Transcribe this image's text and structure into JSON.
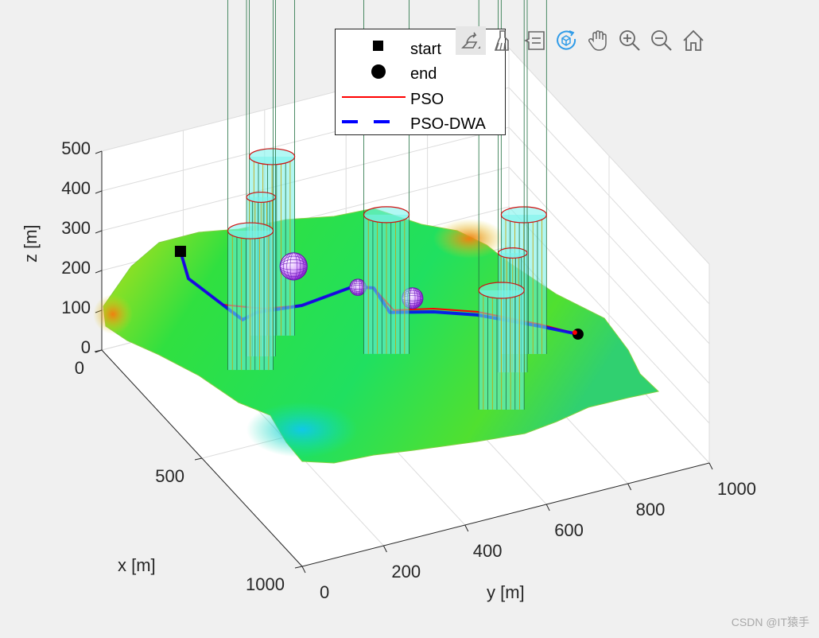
{
  "chart_data": {
    "type": "surface3d",
    "title": "",
    "xlabel": "x [m]",
    "ylabel": "y [m]",
    "zlabel": "z [m]",
    "xlim": [
      0,
      1000
    ],
    "ylim": [
      0,
      1000
    ],
    "zlim": [
      0,
      500
    ],
    "xticks": [
      "0",
      "500",
      "1000"
    ],
    "yticks": [
      "0",
      "200",
      "400",
      "600",
      "800",
      "1000"
    ],
    "zticks": [
      "0",
      "100",
      "200",
      "300",
      "400",
      "500"
    ],
    "grid": true,
    "legend": {
      "placement": "top",
      "entries": [
        {
          "label": "start",
          "marker": "square",
          "color": "#000000"
        },
        {
          "label": "end",
          "marker": "circle",
          "color": "#000000"
        },
        {
          "label": "PSO",
          "line": "solid",
          "color": "#ff0000"
        },
        {
          "label": "PSO-DWA",
          "line": "dashed",
          "color": "#0000ff"
        }
      ]
    },
    "start": [
      33,
      177,
      220
    ],
    "end": [
      542,
      903,
      100
    ],
    "series": [
      {
        "name": "PSO",
        "color": "#ff0000",
        "points": [
          [
            33,
            177,
            220
          ],
          [
            38,
            194,
            150
          ],
          [
            124,
            236,
            120
          ],
          [
            176,
            308,
            120
          ],
          [
            202,
            392,
            120
          ],
          [
            180,
            530,
            120
          ],
          [
            205,
            567,
            120
          ],
          [
            307,
            566,
            120
          ],
          [
            339,
            648,
            120
          ],
          [
            392,
            729,
            120
          ],
          [
            500,
            832,
            120
          ],
          [
            542,
            903,
            100
          ]
        ]
      },
      {
        "name": "PSO-DWA",
        "color": "#0000ff",
        "points": [
          [
            33,
            177,
            220
          ],
          [
            38,
            194,
            150
          ],
          [
            124,
            236,
            120
          ],
          [
            150,
            240,
            120
          ],
          [
            199,
            248,
            120
          ],
          [
            185,
            290,
            120
          ],
          [
            202,
            392,
            120
          ],
          [
            180,
            530,
            120
          ],
          [
            205,
            567,
            120
          ],
          [
            300,
            560,
            112
          ],
          [
            339,
            648,
            112
          ],
          [
            392,
            729,
            112
          ],
          [
            500,
            832,
            115
          ],
          [
            542,
            903,
            100
          ]
        ]
      }
    ],
    "cylinders": [
      {
        "center": [
          108,
          365
        ],
        "radius": 50,
        "height": 450
      },
      {
        "center": [
          175,
          305
        ],
        "radius": 32,
        "height": 400
      },
      {
        "center": [
          216,
          259
        ],
        "radius": 50,
        "height": 350
      },
      {
        "center": [
          285,
          559
        ],
        "radius": 50,
        "height": 350
      },
      {
        "center": [
          416,
          832
        ],
        "radius": 50,
        "height": 350
      },
      {
        "center": [
          474,
          776
        ],
        "radius": 32,
        "height": 300
      },
      {
        "center": [
          603,
          685
        ],
        "radius": 50,
        "height": 300
      }
    ],
    "spheres": [
      {
        "center": [
          167,
          389,
          200
        ],
        "radius": 30
      },
      {
        "center": [
          232,
          515,
          150
        ],
        "radius": 18
      },
      {
        "center": [
          295,
          618,
          130
        ],
        "radius": 23
      }
    ]
  },
  "toolbar": {
    "buttons": [
      {
        "name": "export-icon"
      },
      {
        "name": "brush-icon"
      },
      {
        "name": "datatip-icon"
      },
      {
        "name": "rotate-3d-icon",
        "active": true
      },
      {
        "name": "pan-icon"
      },
      {
        "name": "zoom-in-icon"
      },
      {
        "name": "zoom-out-icon"
      },
      {
        "name": "home-icon"
      }
    ],
    "active_color": "#2f9be8"
  },
  "watermark": "CSDN @IT猿手"
}
